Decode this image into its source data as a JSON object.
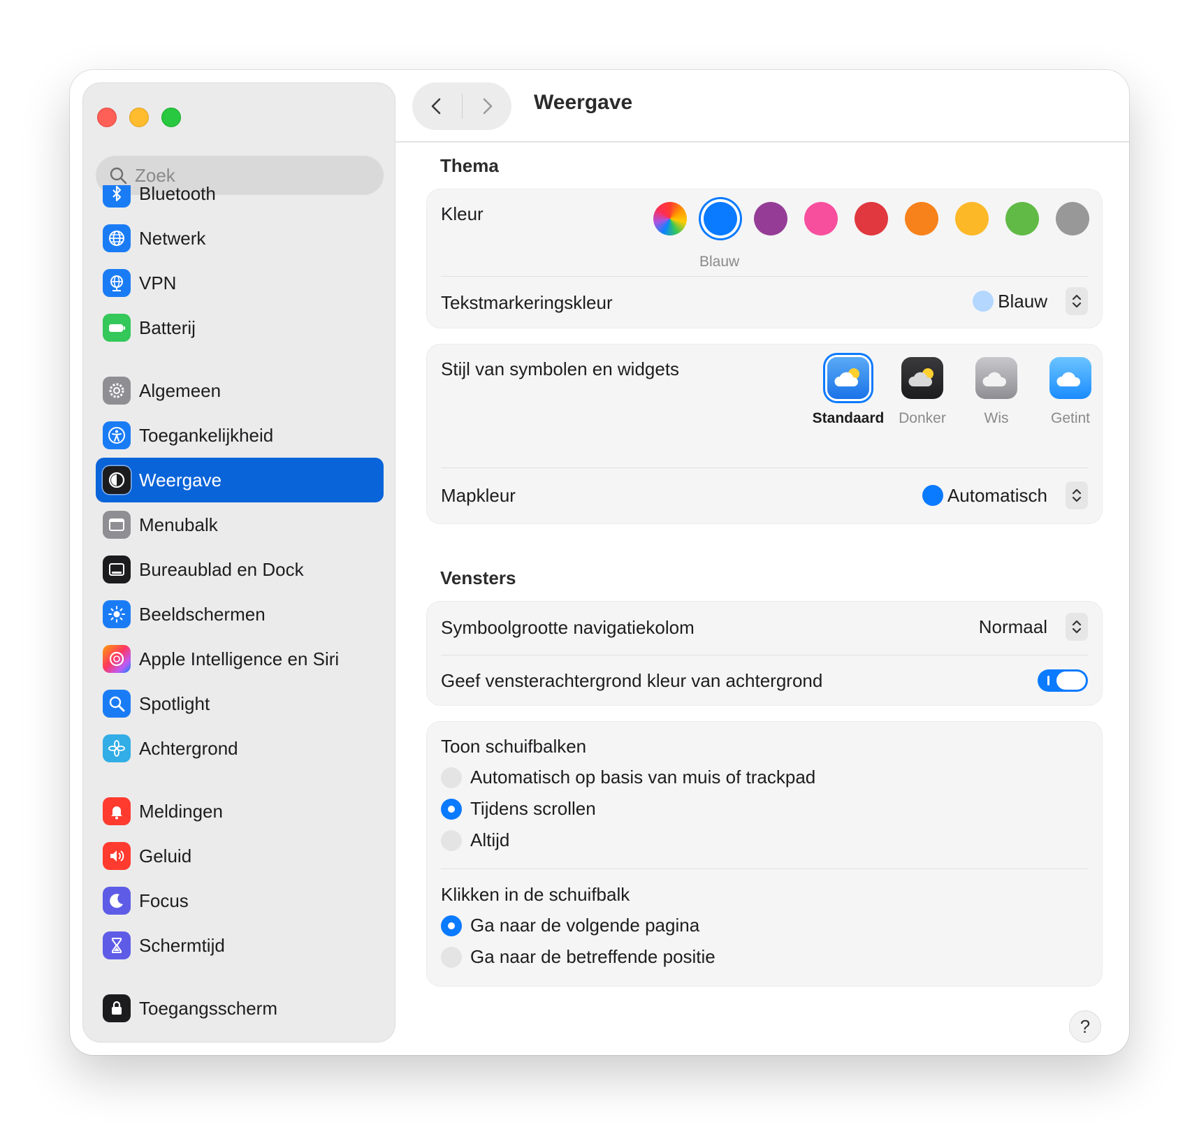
{
  "window": {
    "title": "Weergave"
  },
  "search": {
    "placeholder": "Zoek"
  },
  "sidebar": {
    "items": [
      {
        "label": "Bluetooth",
        "icon": "bluetooth-icon",
        "color": "#1a7cf5"
      },
      {
        "label": "Netwerk",
        "icon": "globe-icon",
        "color": "#1a7cf5"
      },
      {
        "label": "VPN",
        "icon": "vpn-globe-icon",
        "color": "#1a7cf5"
      },
      {
        "label": "Batterij",
        "icon": "battery-icon",
        "color": "#34c759"
      },
      {
        "label": "Algemeen",
        "icon": "gear-icon",
        "color": "#8e8e93"
      },
      {
        "label": "Toegankelijkheid",
        "icon": "accessibility-icon",
        "color": "#1a7cf5"
      },
      {
        "label": "Weergave",
        "icon": "appearance-icon",
        "color": "#1c1c1e",
        "active": true
      },
      {
        "label": "Menubalk",
        "icon": "menubar-icon",
        "color": "#8e8e93"
      },
      {
        "label": "Bureaublad en Dock",
        "icon": "dock-icon",
        "color": "#1c1c1e"
      },
      {
        "label": "Beeldschermen",
        "icon": "sun-icon",
        "color": "#1a7cf5"
      },
      {
        "label": "Apple Intelligence en Siri",
        "icon": "siri-icon",
        "color": "#f06292"
      },
      {
        "label": "Spotlight",
        "icon": "magnifier-icon",
        "color": "#1a7cf5"
      },
      {
        "label": "Achtergrond",
        "icon": "flower-icon",
        "color": "#32ade6"
      },
      {
        "label": "Meldingen",
        "icon": "bell-icon",
        "color": "#ff3b30"
      },
      {
        "label": "Geluid",
        "icon": "speaker-icon",
        "color": "#ff3b30"
      },
      {
        "label": "Focus",
        "icon": "moon-icon",
        "color": "#5e5ce6"
      },
      {
        "label": "Schermtijd",
        "icon": "hourglass-icon",
        "color": "#5e5ce6"
      },
      {
        "label": "Toegangsscherm",
        "icon": "lock-icon",
        "color": "#1c1c1e"
      }
    ]
  },
  "toolbar": {
    "back": "back",
    "forward": "forward"
  },
  "thema": {
    "title": "Thema",
    "kleur_label": "Kleur",
    "kleur_selected_caption": "Blauw",
    "kleur_swatches": [
      {
        "name": "multicolor",
        "color": "multicolor"
      },
      {
        "name": "blue",
        "color": "#0a7aff",
        "selected": true
      },
      {
        "name": "purple",
        "color": "#953d96"
      },
      {
        "name": "pink",
        "color": "#f74f9e"
      },
      {
        "name": "red",
        "color": "#e0383e"
      },
      {
        "name": "orange",
        "color": "#f7821b"
      },
      {
        "name": "yellow",
        "color": "#fcb827"
      },
      {
        "name": "green",
        "color": "#62ba46"
      },
      {
        "name": "graphite",
        "color": "#989898"
      }
    ],
    "highlight_label": "Tekstmarkeringskleur",
    "highlight_value": "Blauw",
    "highlight_color": "#b3d7ff",
    "widgets_label": "Stijl van symbolen en widgets",
    "widget_styles": [
      {
        "label": "Standaard",
        "selected": true
      },
      {
        "label": "Donker"
      },
      {
        "label": "Wis"
      },
      {
        "label": "Getint"
      }
    ],
    "folder_label": "Mapkleur",
    "folder_value": "Automatisch",
    "folder_color": "#0a7aff"
  },
  "vensters": {
    "title": "Vensters",
    "sidebar_icon_label": "Symboolgrootte navigatiekolom",
    "sidebar_icon_value": "Normaal",
    "tint_label": "Geef vensterachtergrond kleur van achtergrond",
    "tint_on": true,
    "scrollbars_label": "Toon schuifbalken",
    "scrollbars_options": [
      {
        "label": "Automatisch op basis van muis of trackpad",
        "checked": false
      },
      {
        "label": "Tijdens scrollen",
        "checked": true
      },
      {
        "label": "Altijd",
        "checked": false
      }
    ],
    "click_label": "Klikken in de schuifbalk",
    "click_options": [
      {
        "label": "Ga naar de volgende pagina",
        "checked": true
      },
      {
        "label": "Ga naar de betreffende positie",
        "checked": false
      }
    ]
  },
  "help": "?"
}
